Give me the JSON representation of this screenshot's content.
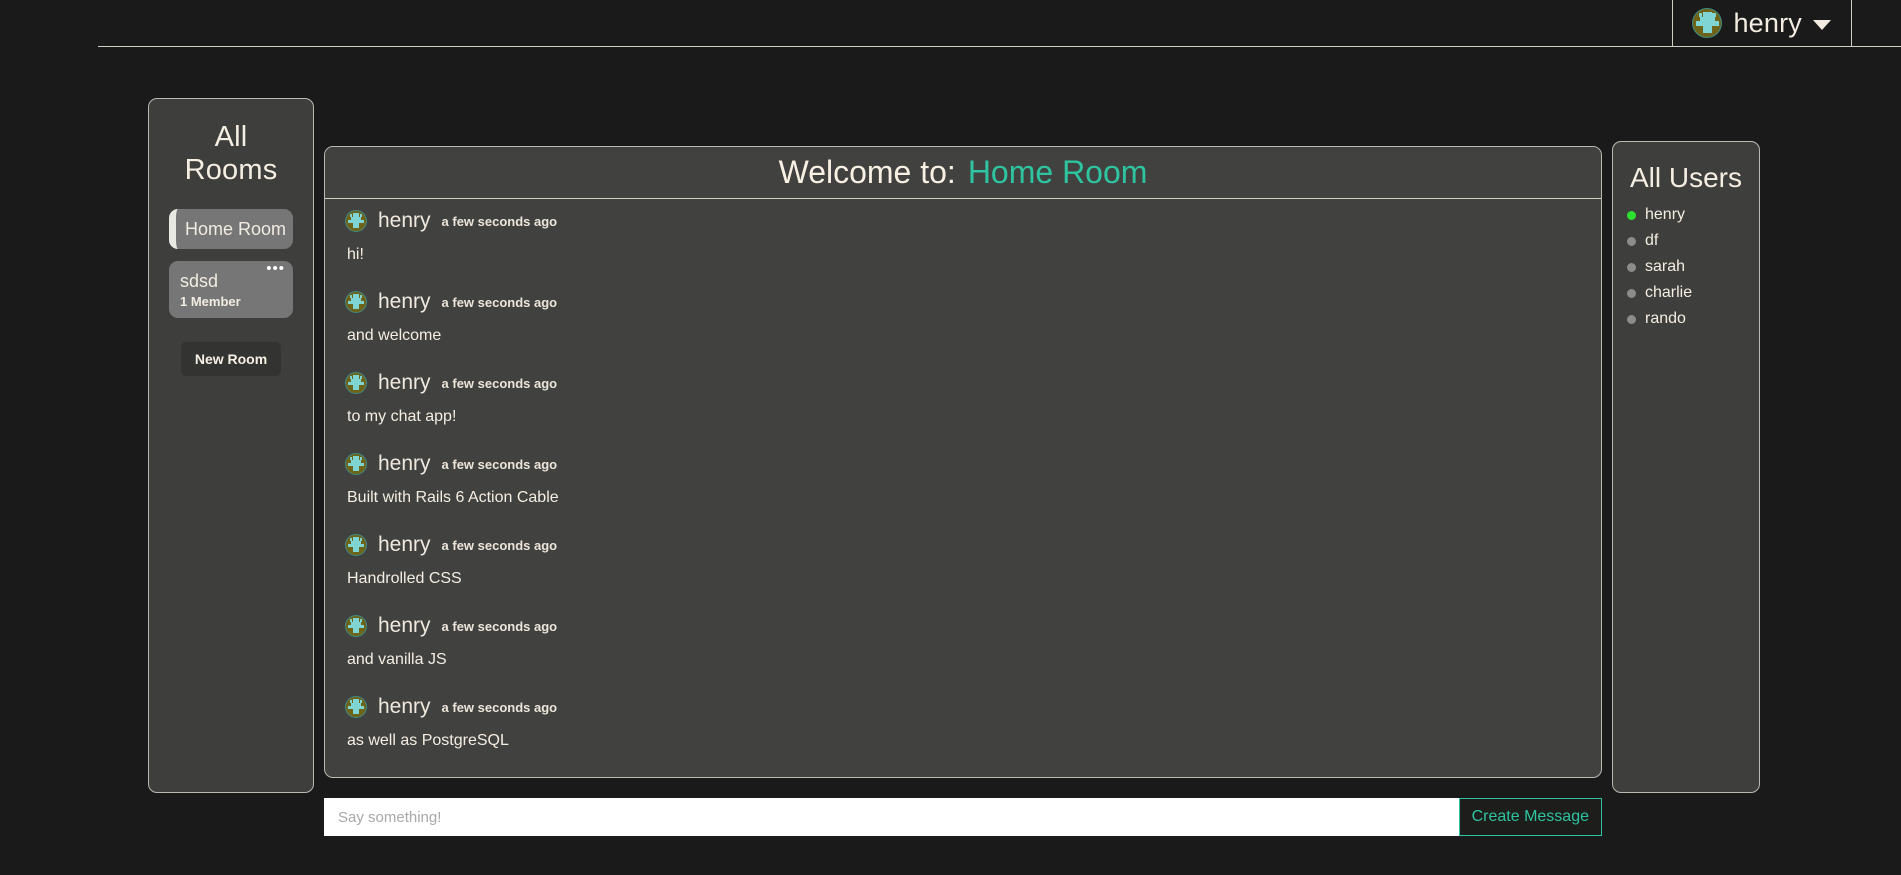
{
  "header": {
    "user_name": "henry",
    "avatar_icon": "pixel-avatar-icon",
    "caret_icon": "chevron-down-icon"
  },
  "rooms_panel": {
    "title": "All Rooms",
    "new_room_label": "New Room",
    "menu_icon": "ellipsis-icon",
    "items": [
      {
        "name": "Home Room",
        "meta": "",
        "active": true,
        "has_menu": false
      },
      {
        "name": "sdsd",
        "meta": "1 Member",
        "active": false,
        "has_menu": true
      }
    ]
  },
  "chat": {
    "welcome_label": "Welcome to:",
    "room_title": "Home Room",
    "messages": [
      {
        "user": "henry",
        "time": "a few seconds ago",
        "body": "hi!"
      },
      {
        "user": "henry",
        "time": "a few seconds ago",
        "body": "and welcome"
      },
      {
        "user": "henry",
        "time": "a few seconds ago",
        "body": "to my chat app!"
      },
      {
        "user": "henry",
        "time": "a few seconds ago",
        "body": "Built with Rails 6 Action Cable"
      },
      {
        "user": "henry",
        "time": "a few seconds ago",
        "body": "Handrolled CSS"
      },
      {
        "user": "henry",
        "time": "a few seconds ago",
        "body": "and vanilla JS"
      },
      {
        "user": "henry",
        "time": "a few seconds ago",
        "body": "as well as PostgreSQL"
      }
    ]
  },
  "composer": {
    "placeholder": "Say something!",
    "value": "",
    "submit_label": "Create Message"
  },
  "users_panel": {
    "title": "All Users",
    "users": [
      {
        "name": "henry",
        "status": "online"
      },
      {
        "name": "df",
        "status": "offline"
      },
      {
        "name": "sarah",
        "status": "offline"
      },
      {
        "name": "charlie",
        "status": "offline"
      },
      {
        "name": "rando",
        "status": "offline"
      }
    ]
  },
  "colors": {
    "accent_teal": "#2ec4a0",
    "online_green": "#2ee02e",
    "offline_gray": "#8c8c8c",
    "page_bg": "#1a1a1a",
    "panel_bg": "#3e3e3c",
    "text_cream": "#f4eee3"
  }
}
